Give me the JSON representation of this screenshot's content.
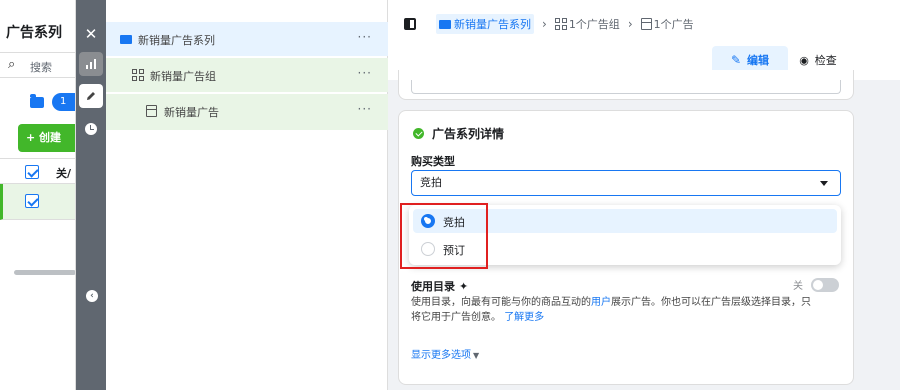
{
  "bg_panel": {
    "title": "广告系列",
    "search_placeholder": "搜索",
    "count_badge": "1",
    "create_label": "+ 创建",
    "header_col": "关/"
  },
  "tree": {
    "items": [
      {
        "label": "新销量广告系列",
        "more": "···"
      },
      {
        "label": "新销量广告组",
        "more": "···"
      },
      {
        "label": "新销量广告",
        "more": "···"
      }
    ]
  },
  "breadcrumb": {
    "campaign": "新销量广告系列",
    "sep1": "›",
    "adset": "1个广告组",
    "sep2": "›",
    "ad": "1个广告"
  },
  "actions": {
    "edit_label": "编辑",
    "check_label": "检查"
  },
  "details": {
    "title": "广告系列详情",
    "buy_type_label": "购买类型",
    "buy_type_value": "竞拍",
    "options": [
      {
        "label": "竞拍",
        "selected": true
      },
      {
        "label": "预订",
        "selected": false
      }
    ],
    "catalog_title": "使用目录",
    "catalog_toggle_label": "关",
    "catalog_desc_1": "使用目录，向最有可能与你的商品互动的",
    "catalog_desc_link": "用户",
    "catalog_desc_2": "展示广告。你也可以在广告层级选择目录，只将它用于广告创意。",
    "learn_more": "了解更多",
    "more_options": "显示更多选项"
  },
  "colors": {
    "accent": "#1877f2",
    "success": "#42b72a",
    "highlight_box": "#e02020"
  },
  "icons": [
    "close-icon",
    "chart-icon",
    "pencil-icon",
    "history-icon",
    "sidebar-toggle-icon",
    "folder-icon",
    "grid-icon",
    "ad-icon",
    "eye-icon",
    "search-icon",
    "check-circle-icon",
    "sparkle-icon",
    "chevron-down-icon"
  ]
}
